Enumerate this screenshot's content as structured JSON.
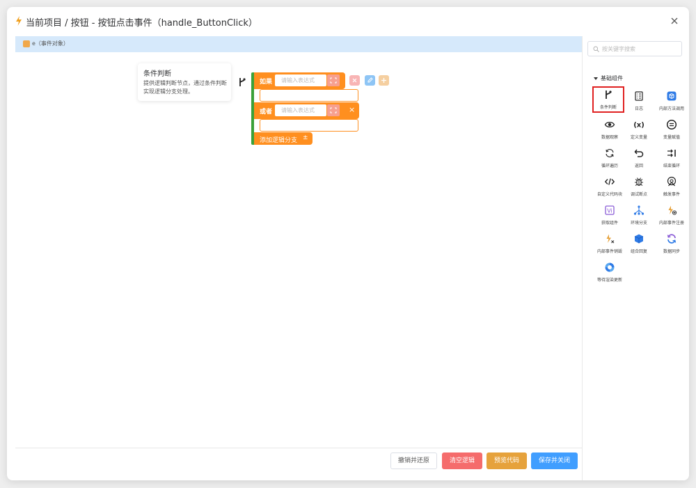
{
  "header": {
    "title": "当前项目 / 按钮 - 按钮点击事件（handle_ButtonClick）"
  },
  "param_bar": {
    "text": "e（事件对象）"
  },
  "tooltip": {
    "title": "条件判断",
    "description": "提供逻辑判断节点，通过条件判断实现逻辑分支处理。"
  },
  "block": {
    "if_label": "如果",
    "or_label": "或者",
    "expr_placeholder": "请输入表达式",
    "add_branch_label": "添加逻辑分支",
    "add_caret": "±",
    "or_close": "×"
  },
  "footer": {
    "reset_label": "撤销并还原",
    "clear_label": "清空逻辑",
    "preview_label": "预览代码",
    "save_label": "保存并关闭"
  },
  "panel": {
    "search_placeholder": "按关键字搜索",
    "group_label": "基础组件",
    "items": [
      {
        "label": "条件判断",
        "icon": "branch-icon",
        "selected": true
      },
      {
        "label": "日志",
        "icon": "log-icon"
      },
      {
        "label": "内部方法调用",
        "icon": "method-call-icon"
      },
      {
        "label": "数据观察",
        "icon": "eye-icon"
      },
      {
        "label": "定义变量",
        "icon": "variable-icon"
      },
      {
        "label": "变量赋值",
        "icon": "assign-icon"
      },
      {
        "label": "循环遍历",
        "icon": "loop-icon"
      },
      {
        "label": "返回",
        "icon": "return-icon"
      },
      {
        "label": "结束循环",
        "icon": "break-icon"
      },
      {
        "label": "自定义代码块",
        "icon": "code-icon"
      },
      {
        "label": "调试断点",
        "icon": "bug-icon"
      },
      {
        "label": "触发事件",
        "icon": "trigger-icon"
      },
      {
        "label": "获取组件",
        "icon": "component-icon"
      },
      {
        "label": "环境分支",
        "icon": "env-branch-icon"
      },
      {
        "label": "内部事件注册",
        "icon": "event-register-icon"
      },
      {
        "label": "内部事件销毁",
        "icon": "event-destroy-icon"
      },
      {
        "label": "组合回复",
        "icon": "cube-icon"
      },
      {
        "label": "数据同步",
        "icon": "sync-icon"
      },
      {
        "label": "等待渲染更新",
        "icon": "wait-render-icon"
      }
    ]
  },
  "colors": {
    "accent": "#409eff",
    "block_orange": "#ff8f1f",
    "block_green": "#3aa13a",
    "danger": "#f56c6c",
    "warning": "#e6a23c"
  }
}
